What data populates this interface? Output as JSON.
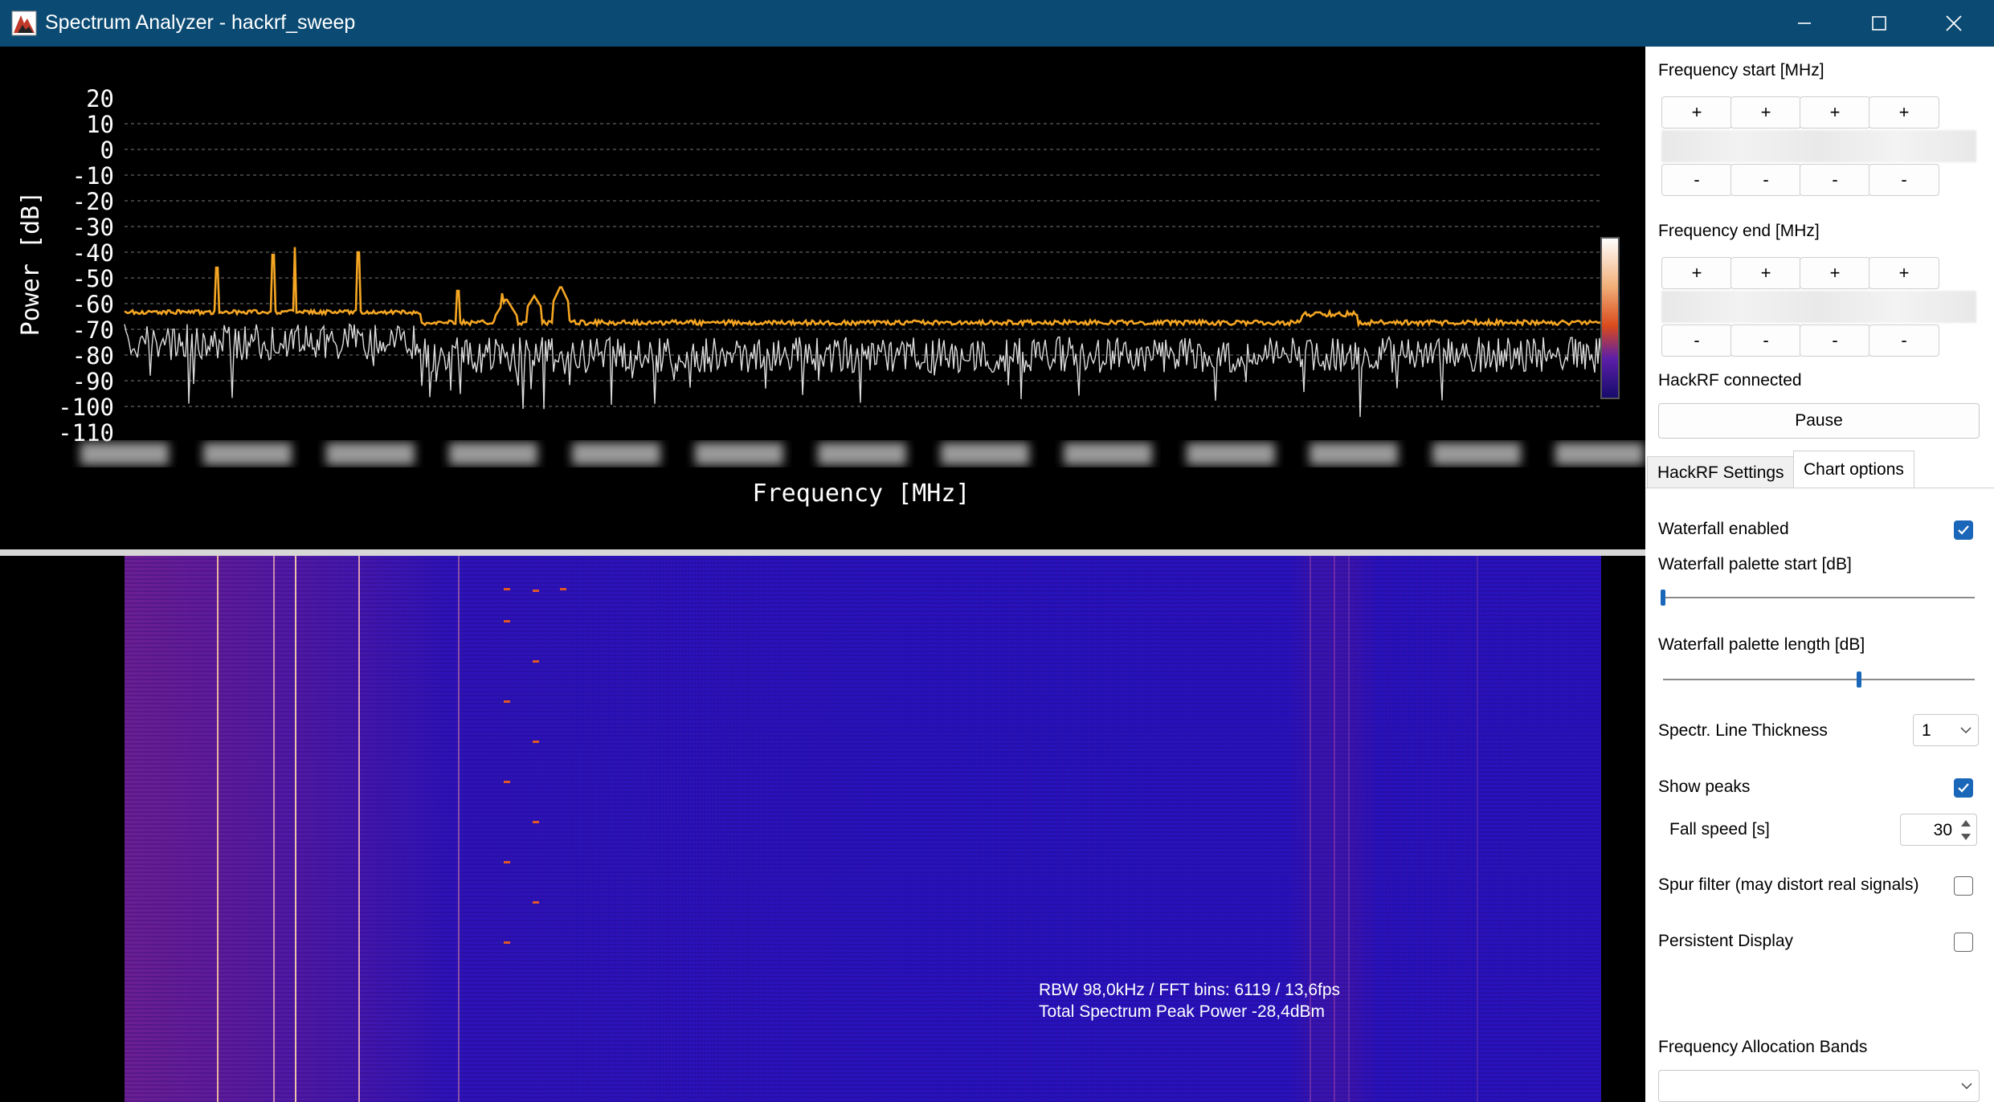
{
  "window": {
    "title": "Spectrum Analyzer - hackrf_sweep",
    "minimize_icon": "minimize-icon",
    "maximize_icon": "maximize-icon",
    "close_icon": "close-icon"
  },
  "spectrum": {
    "ylabel": "Power [dB]",
    "xlabel": "Frequency [MHz]",
    "y_ticks": [
      "20",
      "10",
      "0",
      "-10",
      "-20",
      "-30",
      "-40",
      "-50",
      "-60",
      "-70",
      "-80",
      "-90",
      "-100",
      "-110"
    ],
    "colors": {
      "peak_line": "#f5a623",
      "spectrum_line": "#dcdcdc",
      "grid": "#7a7a7a"
    }
  },
  "waterfall": {
    "info_line1": "RBW 98,0kHz / FFT bins: 6119 / 13,6fps",
    "info_line2": "Total Spectrum Peak Power -28,4dBm"
  },
  "panel": {
    "freq_start_label": "Frequency start [MHz]",
    "freq_end_label": "Frequency end [MHz]",
    "plus": "+",
    "minus": "-",
    "status": "HackRF connected",
    "pause_label": "Pause",
    "tabs": [
      {
        "label": "HackRF Settings",
        "active": false
      },
      {
        "label": "Chart options",
        "active": true
      }
    ],
    "options": {
      "waterfall_enabled": {
        "label": "Waterfall enabled",
        "checked": true
      },
      "palette_start": {
        "label": "Waterfall palette start [dB]",
        "position": 0.0
      },
      "palette_length": {
        "label": "Waterfall palette length [dB]",
        "position": 0.63
      },
      "line_thickness": {
        "label": "Spectr. Line Thickness",
        "value": "1"
      },
      "show_peaks": {
        "label": "Show peaks",
        "checked": true
      },
      "fall_speed": {
        "label": "Fall speed [s]",
        "value": "30"
      },
      "spur_filter": {
        "label": "Spur filter (may distort real signals)",
        "checked": false
      },
      "persistent_display": {
        "label": "Persistent Display",
        "checked": false
      },
      "freq_alloc_bands": {
        "label": "Frequency Allocation Bands",
        "value": ""
      }
    },
    "accent_color": "#1a66b8"
  }
}
